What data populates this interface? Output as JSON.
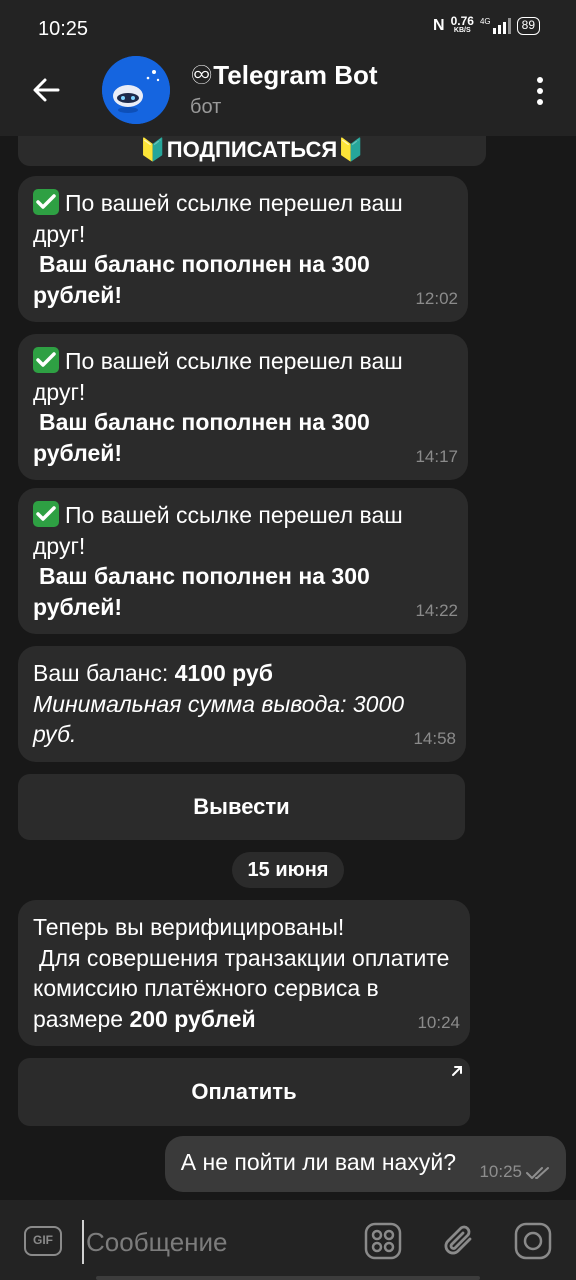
{
  "status_bar": {
    "time": "10:25",
    "net_speed_value": "0.76",
    "net_speed_unit": "KB/S",
    "network": "4G",
    "battery": "89"
  },
  "header": {
    "title": "♾Telegram Bot",
    "subtitle": "бот"
  },
  "chat": {
    "top_partial_button": "🔰ПОДПИСАТЬСЯ🔰",
    "messages": [
      {
        "line1": "По вашей ссылке перешел ваш друг!",
        "line2": "Ваш баланс пополнен на 300 рублей!",
        "time": "12:02"
      },
      {
        "line1": "По вашей ссылке перешел ваш друг!",
        "line2": "Ваш баланс пополнен на 300 рублей!",
        "time": "14:17"
      },
      {
        "line1": "По вашей ссылке перешел ваш друг!",
        "line2": "Ваш баланс пополнен на 300 рублей!",
        "time": "14:22"
      }
    ],
    "balance_message": {
      "label": "Ваш баланс: ",
      "amount": "4100 руб",
      "min_withdraw": "Минимальная сумма вывода: 3000 руб.",
      "time": "14:58"
    },
    "withdraw_button": "Вывести",
    "date_divider": "15 июня",
    "verify_message": {
      "line1": "Теперь вы верифицированы!",
      "line2": "Для совершения транзакции оплатите комиссию платёжного сервиса в размере ",
      "amount": "200 рублей",
      "time": "10:24"
    },
    "pay_button": "Оплатить",
    "outgoing_message": {
      "text": "А не пойти ли вам нахуй?",
      "time": "10:25"
    }
  },
  "composer": {
    "gif_label": "GIF",
    "placeholder": "Сообщение"
  },
  "colors": {
    "background": "#181818",
    "bar": "#232323",
    "bubble_in": "#2b2b2b",
    "bubble_out": "#3a3a3a",
    "avatar": "#1565e0",
    "check_emoji": "#2ea043"
  }
}
